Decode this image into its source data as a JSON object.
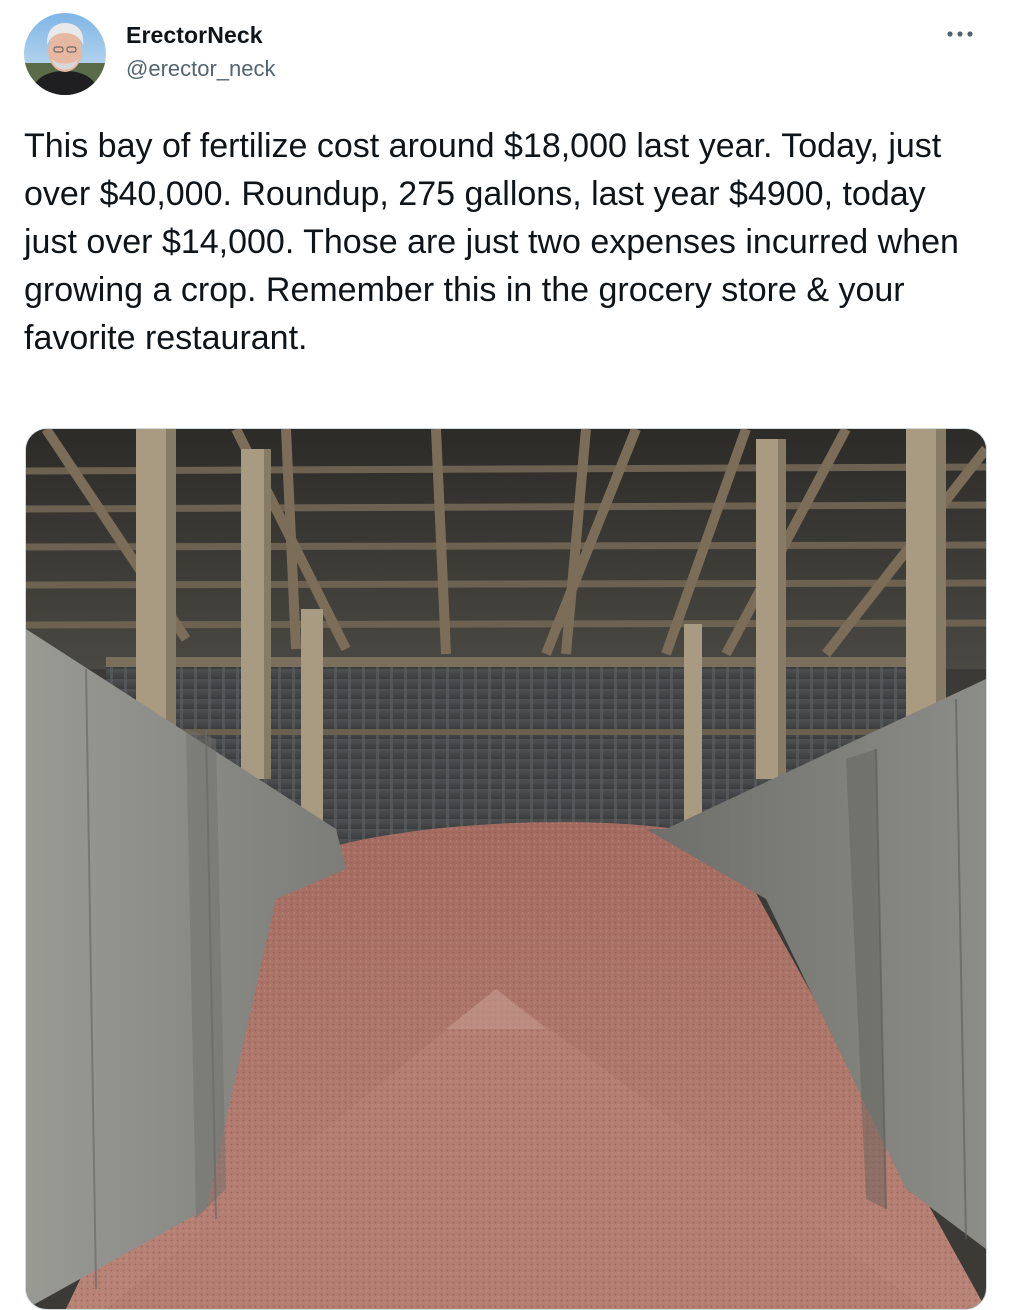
{
  "author": {
    "name": "ErectorNeck",
    "handle": "@erector_neck",
    "avatar_icon": "profile-photo"
  },
  "more_icon": "ellipsis-icon",
  "tweet": {
    "text": "This bay of fertilize cost around $18,000 last year. Today, just over $40,000. Roundup, 275 gallons, last year $4900, today just over $14,000. Those are just two expenses incurred when growing a crop. Remember this in the grocery store & your favorite restaurant."
  },
  "media": {
    "photo_icon": "fertilizer-bay-photo"
  },
  "colors": {
    "text": "#0f1419",
    "secondary_text": "#536471",
    "border": "#cfd9de",
    "fertilizer": "#a86f64",
    "concrete": "#8f8f8a",
    "wood": "#a89a82"
  }
}
